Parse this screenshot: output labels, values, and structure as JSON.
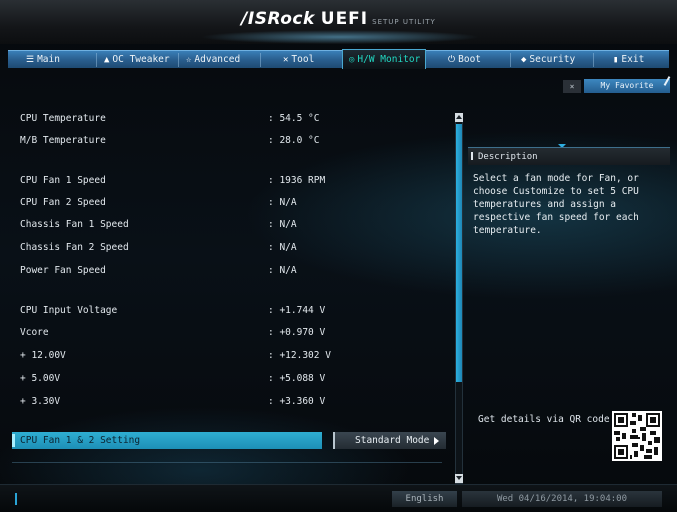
{
  "header": {
    "brand": "/ISRock",
    "product": "UEFI",
    "subtitle": "SETUP UTILITY"
  },
  "tabs": [
    {
      "label": "Main",
      "icon": "list-icon"
    },
    {
      "label": "OC Tweaker",
      "icon": "flame-icon"
    },
    {
      "label": "Advanced",
      "icon": "star-icon"
    },
    {
      "label": "Tool",
      "icon": "tools-icon"
    },
    {
      "label": "H/W Monitor",
      "icon": "monitor-icon",
      "active": true
    },
    {
      "label": "Boot",
      "icon": "power-icon"
    },
    {
      "label": "Security",
      "icon": "shield-icon"
    },
    {
      "label": "Exit",
      "icon": "exit-icon"
    }
  ],
  "favorite": {
    "close_label": "×",
    "label": "My Favorite"
  },
  "sensors": {
    "cpu_temp": {
      "label": "CPU Temperature",
      "value": ": 54.5 °C"
    },
    "mb_temp": {
      "label": "M/B Temperature",
      "value": ": 28.0 °C"
    },
    "cpu_fan1": {
      "label": "CPU Fan 1 Speed",
      "value": ": 1936 RPM"
    },
    "cpu_fan2": {
      "label": "CPU Fan 2 Speed",
      "value": ": N/A"
    },
    "chassis_fan1": {
      "label": "Chassis Fan 1 Speed",
      "value": ": N/A"
    },
    "chassis_fan2": {
      "label": "Chassis Fan 2 Speed",
      "value": ": N/A"
    },
    "power_fan": {
      "label": "Power Fan Speed",
      "value": ": N/A"
    },
    "cpu_voltage": {
      "label": "CPU Input Voltage",
      "value": ": +1.744 V"
    },
    "vcore": {
      "label": "Vcore",
      "value": ": +0.970 V"
    },
    "v12": {
      "label": "+ 12.00V",
      "value": ": +12.302 V"
    },
    "v5": {
      "label": "+ 5.00V",
      "value": ": +5.088 V"
    },
    "v33": {
      "label": "+ 3.30V",
      "value": ": +3.360 V"
    }
  },
  "setting": {
    "label": "CPU Fan 1 & 2 Setting",
    "value": "Standard Mode"
  },
  "description": {
    "title": "Description",
    "text": "Select a fan mode for Fan, or choose Customize to set 5 CPU temperatures and assign a respective fan speed for each temperature.",
    "qr_text": "Get details via QR code"
  },
  "footer": {
    "language": "English",
    "datetime": "Wed 04/16/2014, 19:04:00"
  },
  "colors": {
    "tab_bar": "#2a5f8f",
    "active_tab_text": "#22d7c2",
    "highlight": "#2faed2"
  }
}
